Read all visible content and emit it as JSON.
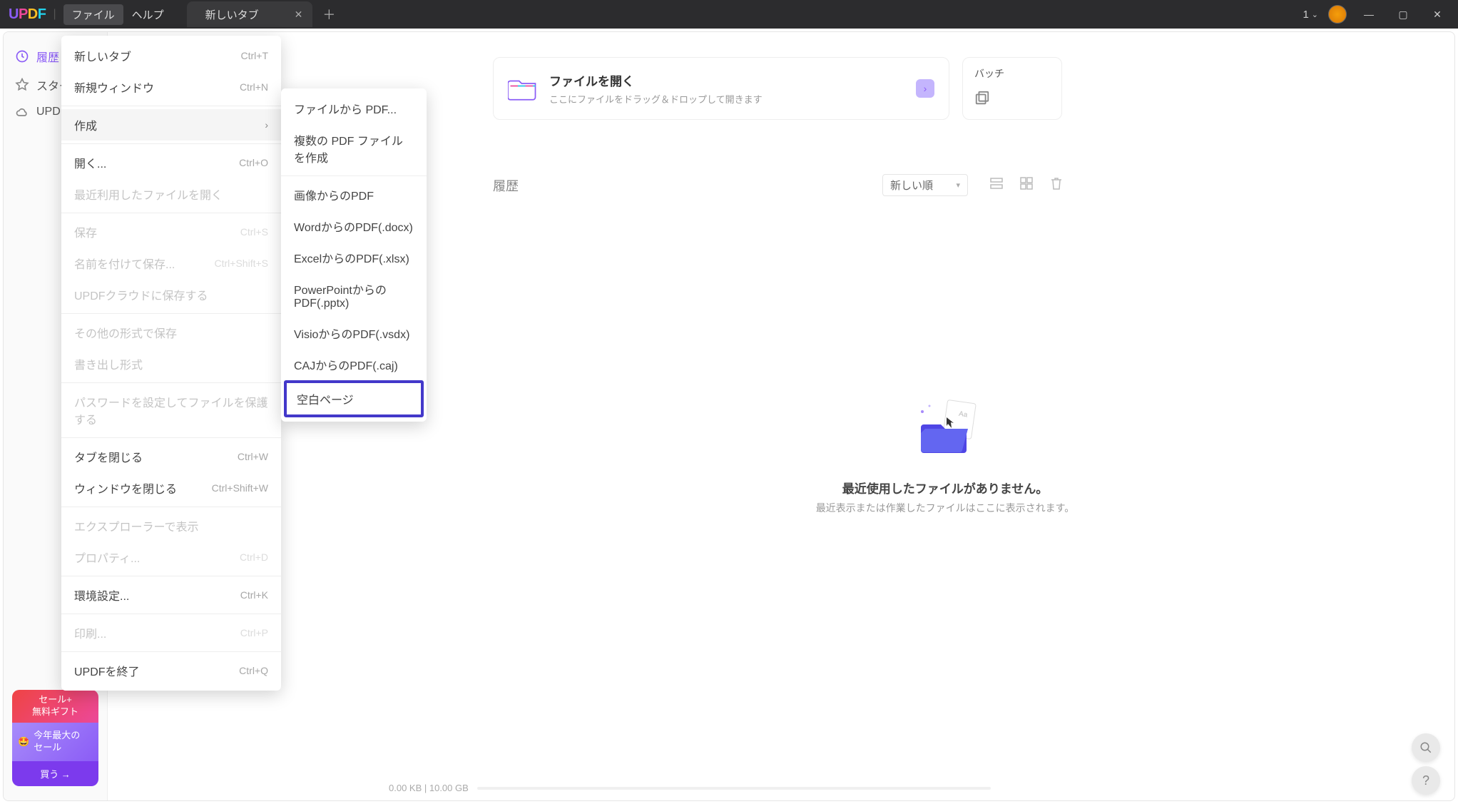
{
  "titlebar": {
    "logo": "UPDF",
    "menu_file": "ファイル",
    "menu_help": "ヘルプ",
    "tab_title": "新しいタブ",
    "tab_count": "1"
  },
  "sidebar": {
    "items": [
      {
        "label": "履歴",
        "icon": "clock"
      },
      {
        "label": "スター",
        "icon": "star"
      },
      {
        "label": "UPDF",
        "icon": "cloud"
      }
    ]
  },
  "promo": {
    "line1": "セール+",
    "line2": "無料ギフト",
    "line3": "今年最大の",
    "line4": "セール",
    "cta": "買う →"
  },
  "open_card": {
    "title": "ファイルを開く",
    "subtitle": "ここにファイルをドラッグ＆ドロップして開きます"
  },
  "batch_card": {
    "title": "バッチ"
  },
  "history": {
    "heading": "履歴",
    "sort": "新しい順"
  },
  "empty": {
    "title": "最近使用したファイルがありません。",
    "subtitle": "最近表示または作業したファイルはここに表示されます。"
  },
  "storage": {
    "text": "0.00 KB | 10.00 GB"
  },
  "file_menu": [
    {
      "label": "新しいタブ",
      "shortcut": "Ctrl+T",
      "enabled": true
    },
    {
      "label": "新規ウィンドウ",
      "shortcut": "Ctrl+N",
      "enabled": true
    },
    {
      "sep": true
    },
    {
      "label": "作成",
      "submenu": true,
      "enabled": true,
      "hover": true
    },
    {
      "sep": true
    },
    {
      "label": "開く...",
      "shortcut": "Ctrl+O",
      "enabled": true
    },
    {
      "label": "最近利用したファイルを開く",
      "enabled": false
    },
    {
      "sep": true
    },
    {
      "label": "保存",
      "shortcut": "Ctrl+S",
      "enabled": false
    },
    {
      "label": "名前を付けて保存...",
      "shortcut": "Ctrl+Shift+S",
      "enabled": false
    },
    {
      "label": "UPDFクラウドに保存する",
      "enabled": false
    },
    {
      "sep": true
    },
    {
      "label": "その他の形式で保存",
      "enabled": false
    },
    {
      "label": "書き出し形式",
      "enabled": false
    },
    {
      "sep": true
    },
    {
      "label": "パスワードを設定してファイルを保護する",
      "enabled": false
    },
    {
      "sep": true
    },
    {
      "label": "タブを閉じる",
      "shortcut": "Ctrl+W",
      "enabled": true
    },
    {
      "label": "ウィンドウを閉じる",
      "shortcut": "Ctrl+Shift+W",
      "enabled": true
    },
    {
      "sep": true
    },
    {
      "label": "エクスプローラーで表示",
      "enabled": false
    },
    {
      "label": "プロパティ...",
      "shortcut": "Ctrl+D",
      "enabled": false
    },
    {
      "sep": true
    },
    {
      "label": "環境設定...",
      "shortcut": "Ctrl+K",
      "enabled": true
    },
    {
      "sep": true
    },
    {
      "label": "印刷...",
      "shortcut": "Ctrl+P",
      "enabled": false
    },
    {
      "sep": true
    },
    {
      "label": "UPDFを終了",
      "shortcut": "Ctrl+Q",
      "enabled": true
    }
  ],
  "create_submenu": [
    {
      "label": "ファイルから PDF..."
    },
    {
      "label": "複数の PDF ファイルを作成"
    },
    {
      "sep": true
    },
    {
      "label": "画像からのPDF"
    },
    {
      "label": "WordからのPDF(.docx)"
    },
    {
      "label": "ExcelからのPDF(.xlsx)"
    },
    {
      "label": "PowerPointからのPDF(.pptx)"
    },
    {
      "label": "VisioからのPDF(.vsdx)"
    },
    {
      "label": "CAJからのPDF(.caj)"
    },
    {
      "label": "空白ページ",
      "highlighted": true
    }
  ]
}
